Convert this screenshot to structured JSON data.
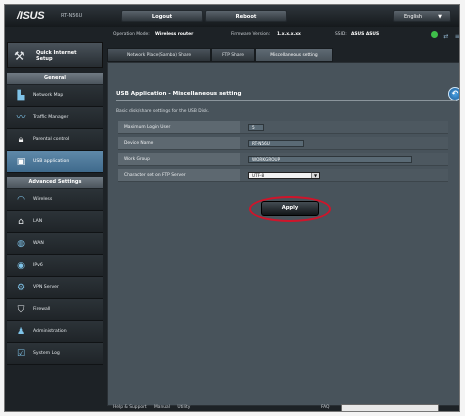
{
  "brand": {
    "logo": "/ISUS",
    "model": "RT-N56U"
  },
  "topbar": {
    "logout": "Logout",
    "reboot": "Reboot",
    "language": "English"
  },
  "status": {
    "op_mode_label": "Operation Mode:",
    "op_mode_value": "Wireless router",
    "firmware_label": "Firmware Version:",
    "firmware_value": "1.x.x.x.xx",
    "ssid_label": "SSID:",
    "ssid_value": "ASUS ASUS"
  },
  "sidebar": {
    "quick_setup": {
      "line1": "Quick Internet",
      "line2": "Setup"
    },
    "general_header": "General",
    "general": [
      {
        "label": "Network Map",
        "icon": "network-map-icon"
      },
      {
        "label": "Traffic Manager",
        "icon": "traffic-icon"
      },
      {
        "label": "Parental control",
        "icon": "lock-icon"
      },
      {
        "label": "USB application",
        "icon": "usb-icon"
      }
    ],
    "advanced_header": "Advanced Settings",
    "advanced": [
      {
        "label": "Wireless",
        "icon": "wifi-icon"
      },
      {
        "label": "LAN",
        "icon": "house-icon"
      },
      {
        "label": "WAN",
        "icon": "globe-icon"
      },
      {
        "label": "IPv6",
        "icon": "ipv6-icon"
      },
      {
        "label": "VPN Server",
        "icon": "vpn-icon"
      },
      {
        "label": "Firewall",
        "icon": "shield-icon"
      },
      {
        "label": "Administration",
        "icon": "admin-icon"
      },
      {
        "label": "System Log",
        "icon": "log-icon"
      }
    ]
  },
  "tabs": [
    {
      "label": "Network Place(Samba) Share"
    },
    {
      "label": "FTP Share"
    },
    {
      "label": "Miscellaneous setting"
    }
  ],
  "main": {
    "title": "USB Application - Miscellaneous setting",
    "description": "Basic disk/share settings for the USB Disk.",
    "fields": [
      {
        "label": "Maximum Login User",
        "value": "5"
      },
      {
        "label": "Device Name",
        "value": "RT-N56U"
      },
      {
        "label": "Work Group",
        "value": "WORKGROUP"
      },
      {
        "label": "Character set on FTP Server",
        "value": "UTF-8"
      }
    ],
    "apply": "Apply"
  },
  "footer": {
    "help": "Help & Support",
    "manual": "Manual",
    "utility": "Utility",
    "faq": "FAQ"
  },
  "colors": {
    "active_nav": "#4f7a9c",
    "apply_ring": "#d0142a"
  }
}
